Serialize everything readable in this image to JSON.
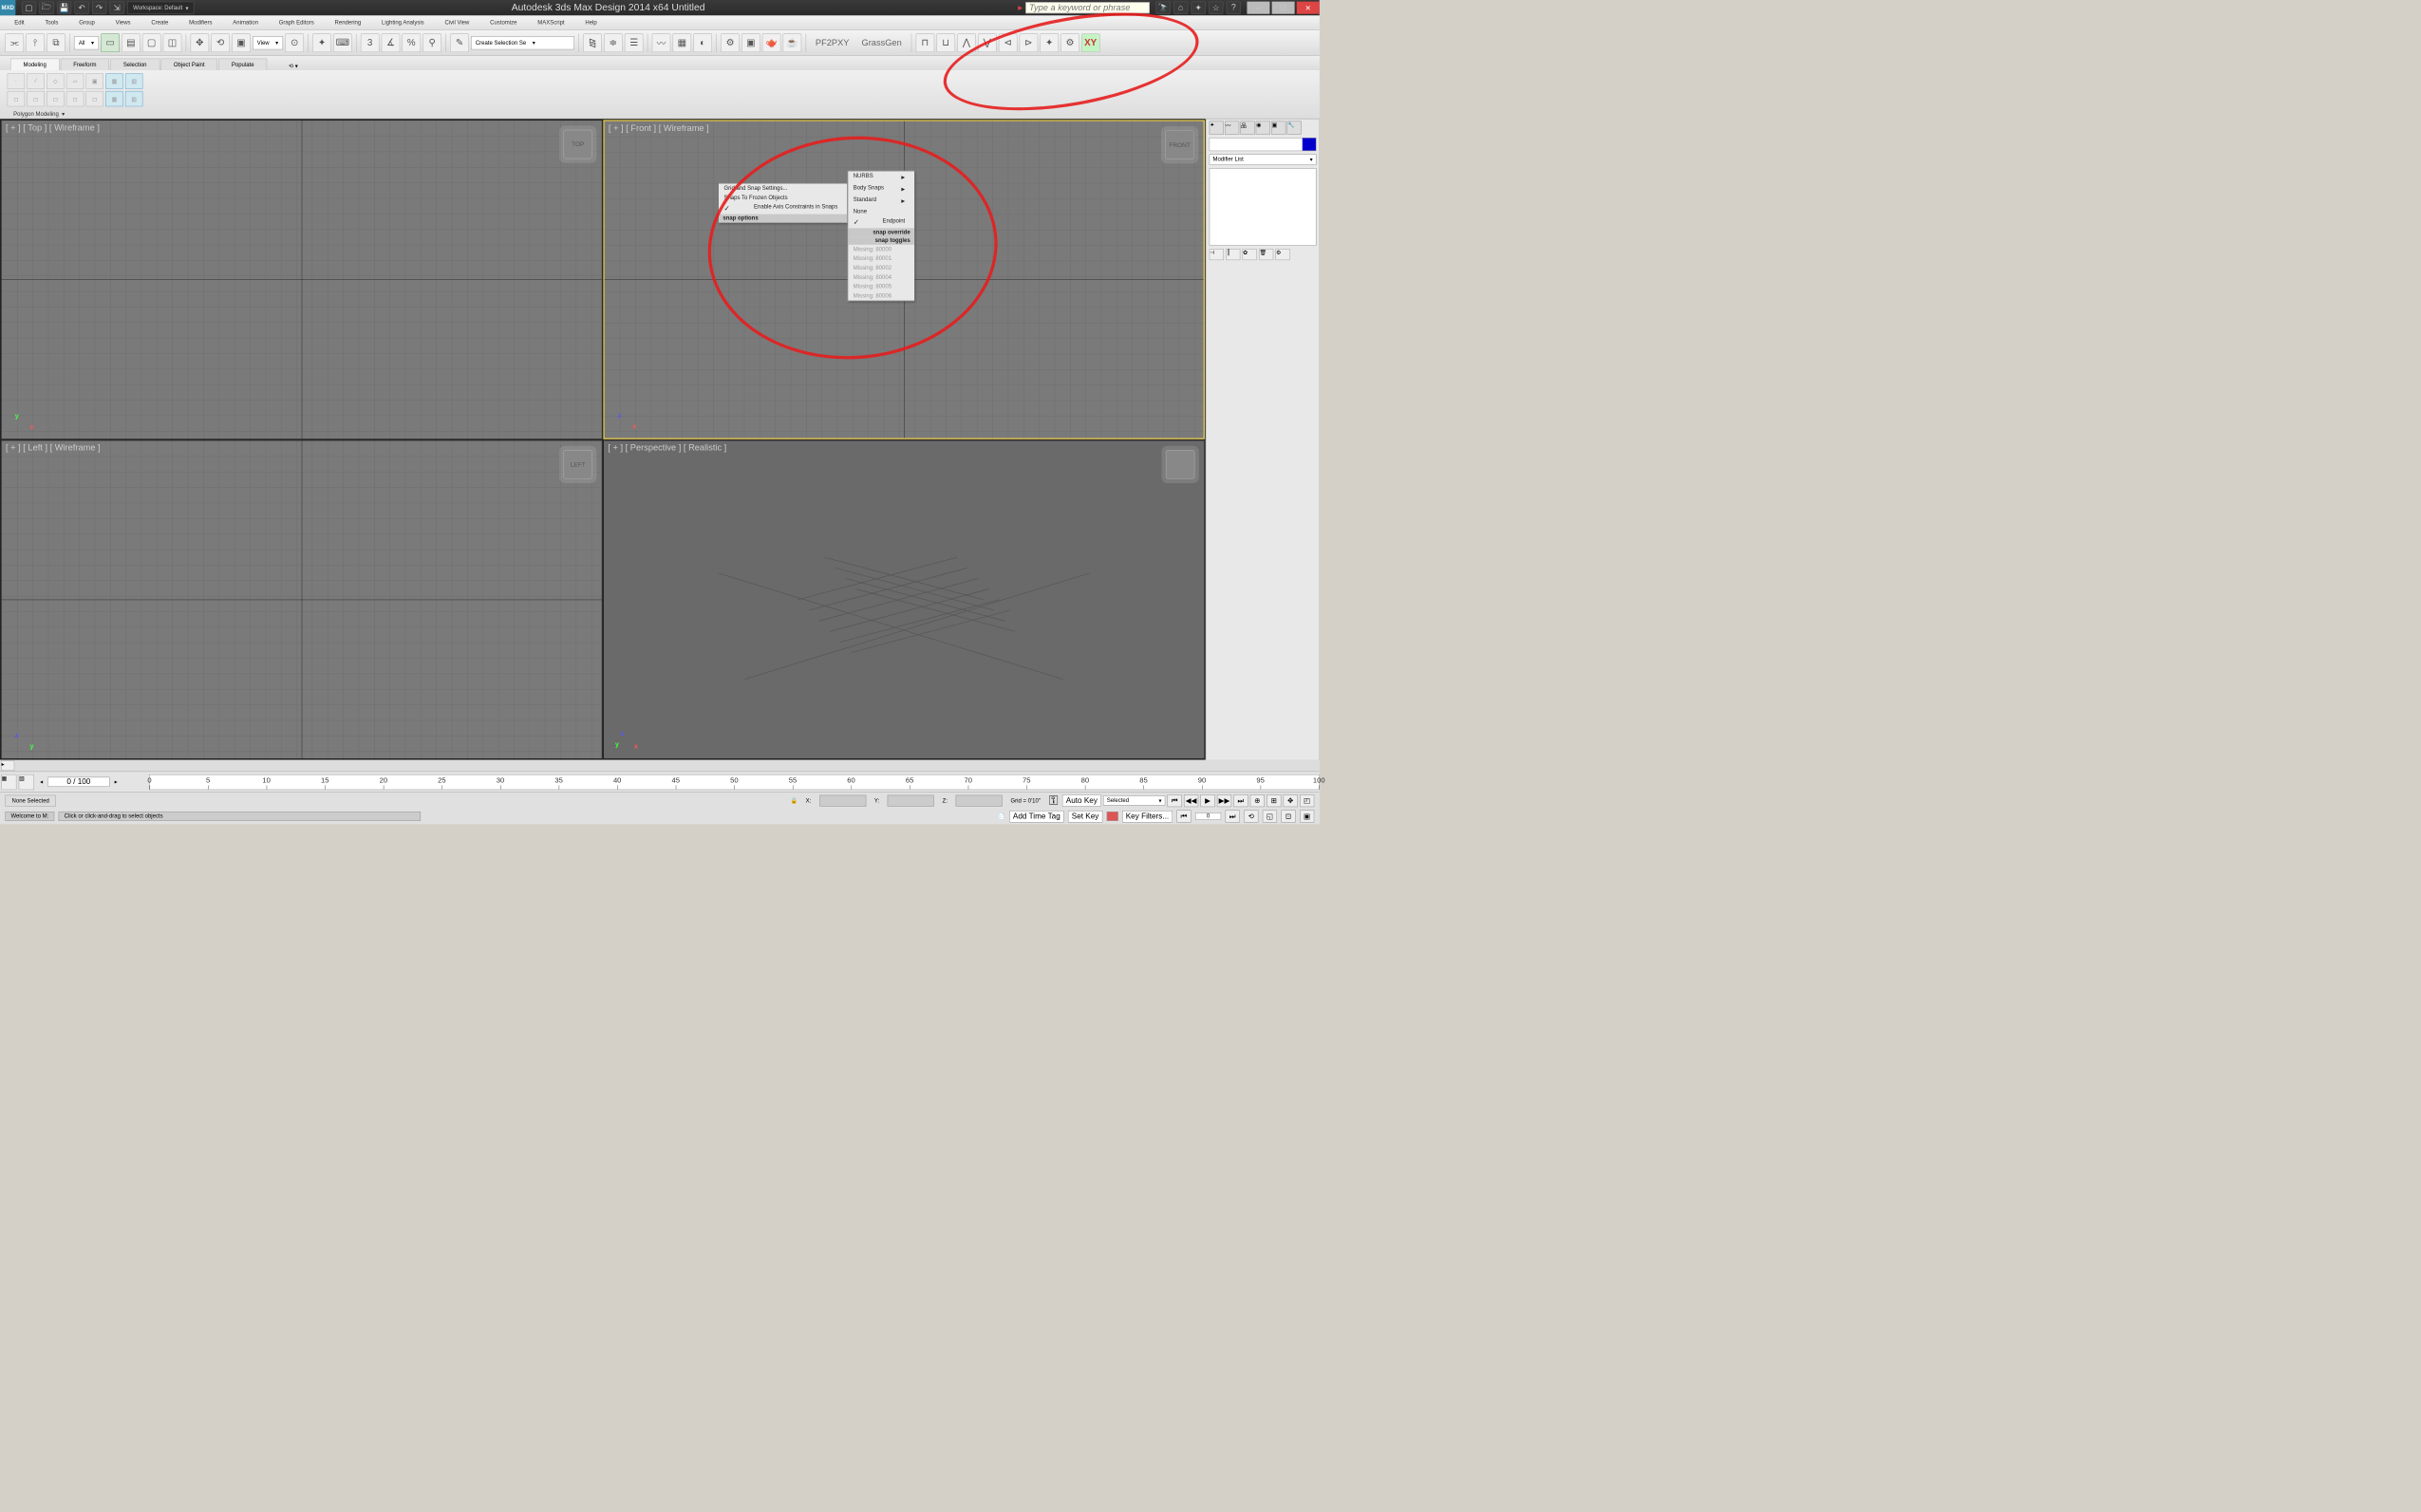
{
  "app": {
    "title_full": "Autodesk 3ds Max Design 2014 x64    Untitled",
    "logo": "MXD"
  },
  "qat": {
    "workspace_label": "Workspace: Default"
  },
  "search": {
    "placeholder": "Type a keyword or phrase"
  },
  "menu": [
    "Edit",
    "Tools",
    "Group",
    "Views",
    "Create",
    "Modifiers",
    "Animation",
    "Graph Editors",
    "Rendering",
    "Lighting Analysis",
    "Civil View",
    "Customize",
    "MAXScript",
    "Help"
  ],
  "toolbarLabels": {
    "all": "All",
    "view": "View",
    "createSel": "Create Selection Se",
    "pf2pxy": "PF2PXY",
    "grassgen": "GrassGen",
    "xy": "XY"
  },
  "ribbonTabs": [
    "Modeling",
    "Freeform",
    "Selection",
    "Object Paint",
    "Populate"
  ],
  "ribbonGroup": "Polygon Modeling",
  "viewports": {
    "tl": "[ + ] [ Top ] [ Wireframe ]",
    "tr": "[ + ] [ Front ] [ Wireframe ]",
    "bl": "[ + ] [ Left ] [ Wireframe ]",
    "br": "[ + ] [ Perspective ] [ Realistic ]",
    "cubes": {
      "top": "TOP",
      "front": "FRONT",
      "left": "LEFT"
    }
  },
  "ctx": {
    "header1": "snap options",
    "items1": [
      "Grid and Snap Settings...",
      "Snaps To Frozen Objects",
      "Enable Axis Constraints in Snaps"
    ],
    "sub1": [
      "NURBS",
      "Body Snaps",
      "Standard"
    ],
    "sub2": [
      "None",
      "Endpoint"
    ],
    "header2": "snap override",
    "header3": "snap toggles",
    "missing": [
      "Missing: 80000",
      "Missing: 80001",
      "Missing: 80002",
      "Missing: 80004",
      "Missing: 80005",
      "Missing: 80006"
    ]
  },
  "cmdpanel": {
    "modlist": "Modifier List"
  },
  "timeline": {
    "range": "0 / 100",
    "ticks": [
      0,
      5,
      10,
      15,
      20,
      25,
      30,
      35,
      40,
      45,
      50,
      55,
      60,
      65,
      70,
      75,
      80,
      85,
      90,
      95,
      100
    ]
  },
  "status": {
    "none_sel": "None Selected",
    "x": "X:",
    "y": "Y:",
    "z": "Z:",
    "grid": "Grid = 0'10\"",
    "autokey": "Auto Key",
    "selected": "Selected",
    "setkey": "Set Key",
    "keyfilters": "Key Filters...",
    "welcome": "Welcome to M:",
    "prompt": "Click or click-and-drag to select objects",
    "addtag": "Add Time Tag"
  }
}
